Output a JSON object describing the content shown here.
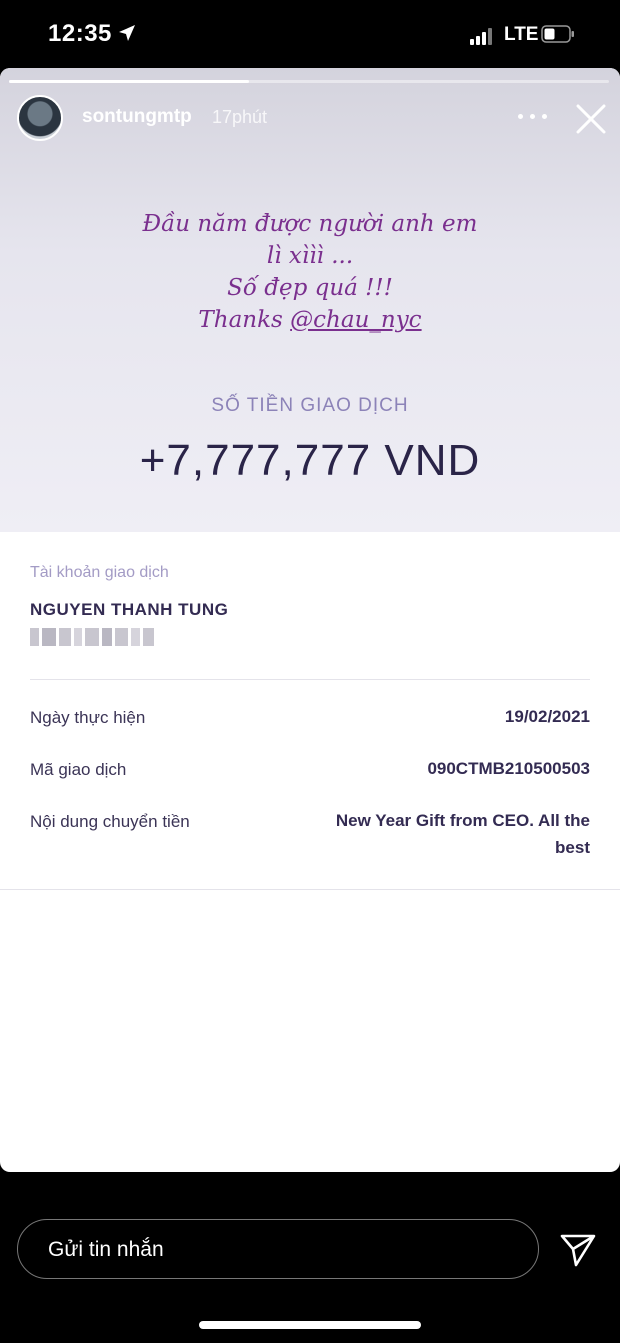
{
  "status_bar": {
    "time": "12:35",
    "network": "LTE",
    "icons": [
      "location-arrow-icon",
      "signal-icon",
      "battery-icon"
    ]
  },
  "story": {
    "progress": 0.4,
    "username": "sontungmtp",
    "time_ago": "17phút",
    "more_icon": "more-dots-icon",
    "close_icon": "close-icon",
    "caption": {
      "line1": "Đầu năm được người anh em",
      "line2": "lì xììì ...",
      "line3": "Số đẹp quá !!!",
      "line4_prefix": "Thanks ",
      "mention": "@chau_nyc"
    }
  },
  "transaction": {
    "amount_label": "SỐ TIỀN GIAO DỊCH",
    "amount": "+7,777,777 VND",
    "account_label": "Tài khoản giao dịch",
    "account_name": "NGUYEN THANH TUNG",
    "rows": [
      {
        "label": "Ngày thực hiện",
        "value": "19/02/2021"
      },
      {
        "label": "Mã giao dịch",
        "value": "090CTMB210500503"
      },
      {
        "label": "Nội dung chuyển tiền",
        "value_line1": "New Year Gift from CEO. All the",
        "value_line2": "best"
      }
    ]
  },
  "reply": {
    "placeholder": "Gửi tin nhắn",
    "send_icon": "send-icon"
  },
  "colors": {
    "caption": "#7a2f8e",
    "amount_label": "#8c83b8",
    "amount": "#2a2448",
    "label_muted": "#a39bc5"
  }
}
